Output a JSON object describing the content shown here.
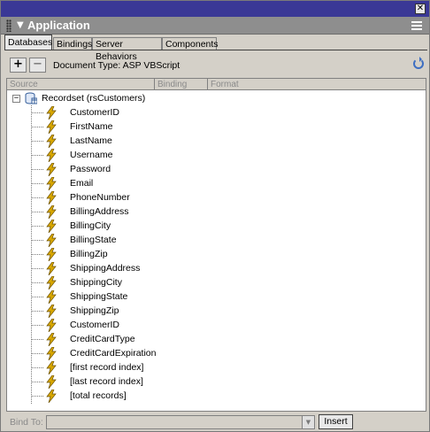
{
  "window": {
    "close_glyph": "✕"
  },
  "panel": {
    "title": "Application",
    "collapse_icon": "triangle-down-icon",
    "options_icon": "options-menu-icon"
  },
  "tabs": [
    {
      "label": "Databases",
      "active": true
    },
    {
      "label": "Bindings",
      "active": false
    },
    {
      "label": "Server Behaviors",
      "active": false
    },
    {
      "label": "Components",
      "active": false
    }
  ],
  "toolbar": {
    "add_label": "+",
    "remove_label": "−",
    "doc_type": "Document Type: ASP VBScript"
  },
  "columns": [
    "Source",
    "Binding",
    "Format"
  ],
  "recordset": {
    "expander": "−",
    "label": "Recordset (rsCustomers)",
    "fields": [
      "CustomerID",
      "FirstName",
      "LastName",
      "Username",
      "Password",
      "Email",
      "PhoneNumber",
      "BillingAddress",
      "BillingCity",
      "BillingState",
      "BillingZip",
      "ShippingAddress",
      "ShippingCity",
      "ShippingState",
      "ShippingZip",
      "CustomerID",
      "CreditCardType",
      "CreditCardExpiration",
      "[first record index]",
      "[last record index]",
      "[total records]"
    ]
  },
  "bottom": {
    "bind_label": "Bind To:",
    "bind_value": "",
    "insert_label": "Insert"
  },
  "colors": {
    "title_bar": "#3a3896",
    "panel_header": "#8e8e8e",
    "chrome": "#d4d0c8",
    "bolt": "#d9a800"
  }
}
